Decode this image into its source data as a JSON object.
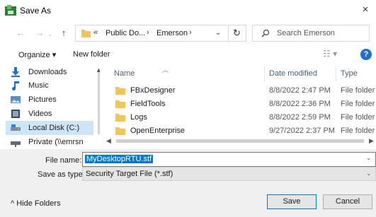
{
  "window": {
    "title": "Save As",
    "close_glyph": "×"
  },
  "nav": {
    "back_glyph": "←",
    "forward_glyph": "→",
    "up_glyph": "↑",
    "address": {
      "overflow_glyph": "«",
      "crumbs": [
        "Public Do...",
        "Emerson"
      ],
      "separator": "›",
      "dropdown_glyph": "⌄"
    },
    "refresh_glyph": "↻",
    "search_placeholder": "Search Emerson"
  },
  "toolbar": {
    "organize_label": "Organize ▾",
    "new_folder_label": "New folder",
    "view_glyph": "☷ ▾",
    "help_glyph": "?"
  },
  "sidebar": {
    "items": [
      {
        "label": "Downloads",
        "icon": "download-arrow-icon"
      },
      {
        "label": "Music",
        "icon": "music-note-icon"
      },
      {
        "label": "Pictures",
        "icon": "pictures-icon"
      },
      {
        "label": "Videos",
        "icon": "videos-icon"
      },
      {
        "label": "Local Disk (C:)",
        "icon": "drive-icon",
        "selected": true
      },
      {
        "label": "Private (\\\\emrsn",
        "icon": "network-drive-icon"
      }
    ]
  },
  "files": {
    "columns": {
      "name": "Name",
      "date": "Date modified",
      "type": "Type"
    },
    "rows": [
      {
        "name": "FBxDesigner",
        "date": "8/8/2022 2:47 PM",
        "type": "File folder"
      },
      {
        "name": "FieldTools",
        "date": "8/8/2022 2:36 PM",
        "type": "File folder"
      },
      {
        "name": "Logs",
        "date": "8/8/2022 2:59 PM",
        "type": "File folder"
      },
      {
        "name": "OpenEnterprise",
        "date": "9/27/2022 2:37 PM",
        "type": "File folder"
      }
    ]
  },
  "form": {
    "file_name_label": "File name:",
    "file_name_value": "MyDesktopRTU.stf",
    "save_type_label": "Save as type:",
    "save_type_value": "Security Target File (*.stf)"
  },
  "footer": {
    "hide_folders_label": "^  Hide Folders",
    "save_label": "Save",
    "cancel_label": "Cancel"
  },
  "colors": {
    "accent": "#0078d7",
    "folder": "#f5c453",
    "selection": "#cde6f7"
  }
}
